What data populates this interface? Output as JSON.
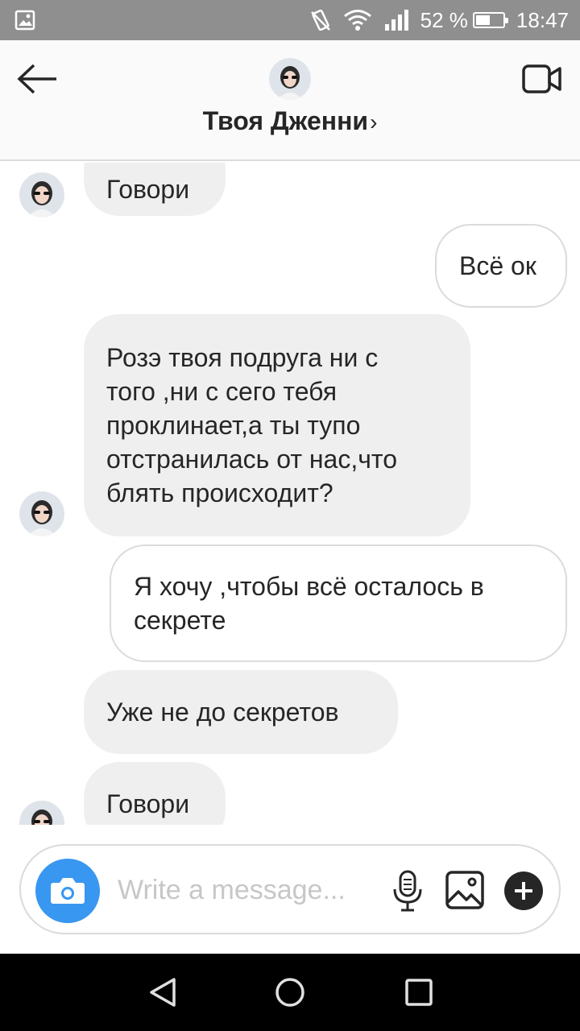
{
  "status_bar": {
    "battery_percent": "52 %",
    "battery_level": 0.52,
    "time": "18:47"
  },
  "header": {
    "title": "Твоя Дженни",
    "chevron": "›",
    "icons": {
      "back": "arrow-left-icon",
      "video": "video-camera-icon"
    }
  },
  "messages": [
    {
      "side": "in",
      "text": "Говори",
      "avatar": true
    },
    {
      "side": "out",
      "text": "Всё ок"
    },
    {
      "side": "in",
      "lines": [
        "Розэ твоя подруга ни с",
        "того ,ни с сего тебя",
        "проклинает,а ты тупо",
        "отстранилась от нас,что",
        "блять происходит?"
      ],
      "avatar": true
    },
    {
      "side": "out",
      "lines": [
        "Я хочу ,чтобы всё осталось в",
        "секрете"
      ]
    },
    {
      "side": "in",
      "text": "Уже не до секретов"
    },
    {
      "side": "in",
      "text": "Говори",
      "avatar": true
    }
  ],
  "composer": {
    "placeholder": "Write a message...",
    "icons": [
      "camera-icon",
      "microphone-icon",
      "gallery-icon",
      "plus-icon"
    ]
  },
  "colors": {
    "accent": "#3897f0",
    "incoming_bubble": "#efefef",
    "border": "#dbdbdb",
    "status_bar": "#8f8f8f"
  }
}
